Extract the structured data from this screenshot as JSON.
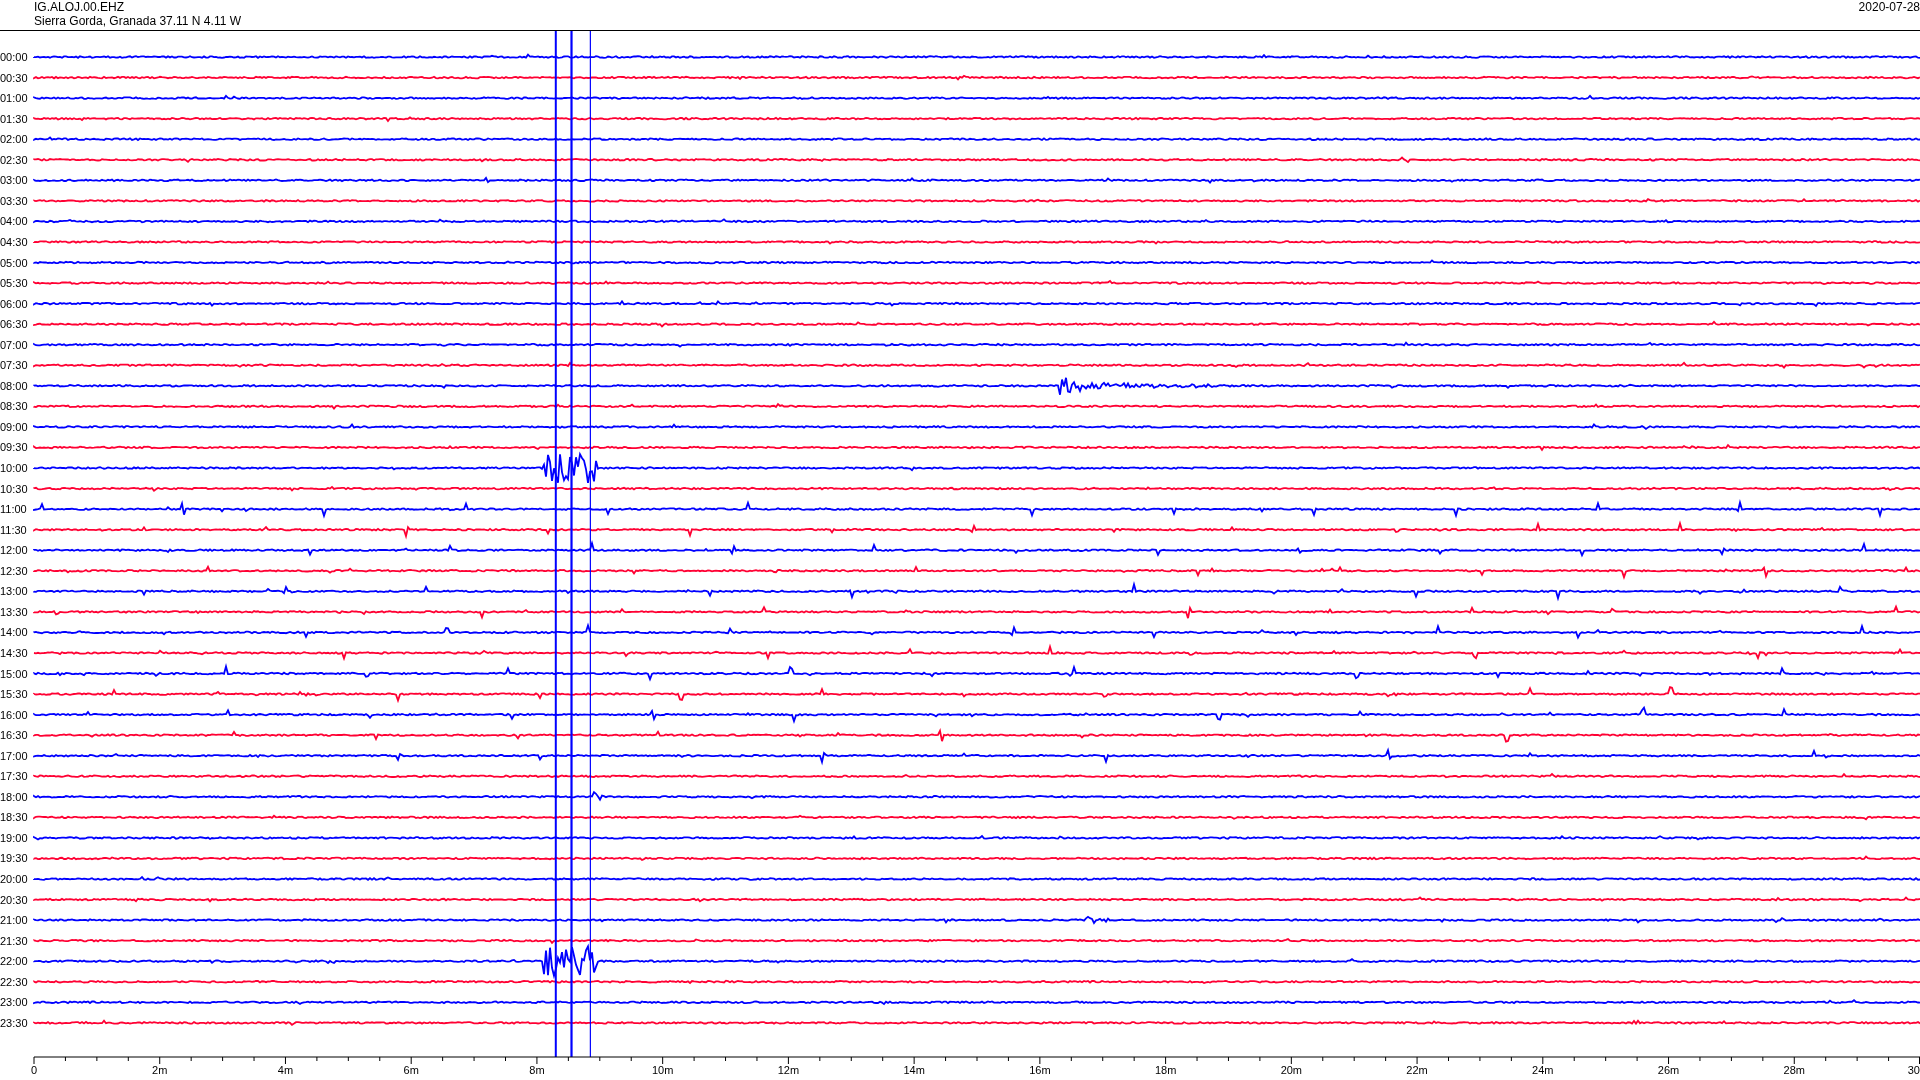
{
  "header": {
    "station": "IG.ALOJ.00.EHZ",
    "location": "Sierra Gorda, Granada  37.11 N 4.11 W",
    "date": "2020-07-28"
  },
  "rows": [
    {
      "label": "00:00",
      "color": "#0000ff"
    },
    {
      "label": "00:30",
      "color": "#ff0033"
    },
    {
      "label": "01:00",
      "color": "#0000ff"
    },
    {
      "label": "01:30",
      "color": "#ff0033"
    },
    {
      "label": "02:00",
      "color": "#0000ff"
    },
    {
      "label": "02:30",
      "color": "#ff0033"
    },
    {
      "label": "03:00",
      "color": "#0000ff"
    },
    {
      "label": "03:30",
      "color": "#ff0033"
    },
    {
      "label": "04:00",
      "color": "#0000ff"
    },
    {
      "label": "04:30",
      "color": "#ff0033"
    },
    {
      "label": "05:00",
      "color": "#0000ff"
    },
    {
      "label": "05:30",
      "color": "#ff0033"
    },
    {
      "label": "06:00",
      "color": "#0000ff"
    },
    {
      "label": "06:30",
      "color": "#ff0033"
    },
    {
      "label": "07:00",
      "color": "#0000ff"
    },
    {
      "label": "07:30",
      "color": "#ff0033"
    },
    {
      "label": "08:00",
      "color": "#0000ff"
    },
    {
      "label": "08:30",
      "color": "#ff0033"
    },
    {
      "label": "09:00",
      "color": "#0000ff"
    },
    {
      "label": "09:30",
      "color": "#ff0033"
    },
    {
      "label": "10:00",
      "color": "#0000ff"
    },
    {
      "label": "10:30",
      "color": "#ff0033"
    },
    {
      "label": "11:00",
      "color": "#0000ff"
    },
    {
      "label": "11:30",
      "color": "#ff0033"
    },
    {
      "label": "12:00",
      "color": "#0000ff"
    },
    {
      "label": "12:30",
      "color": "#ff0033"
    },
    {
      "label": "13:00",
      "color": "#0000ff"
    },
    {
      "label": "13:30",
      "color": "#ff0033"
    },
    {
      "label": "14:00",
      "color": "#0000ff"
    },
    {
      "label": "14:30",
      "color": "#ff0033"
    },
    {
      "label": "15:00",
      "color": "#0000ff"
    },
    {
      "label": "15:30",
      "color": "#ff0033"
    },
    {
      "label": "16:00",
      "color": "#0000ff"
    },
    {
      "label": "16:30",
      "color": "#ff0033"
    },
    {
      "label": "17:00",
      "color": "#0000ff"
    },
    {
      "label": "17:30",
      "color": "#ff0033"
    },
    {
      "label": "18:00",
      "color": "#0000ff"
    },
    {
      "label": "18:30",
      "color": "#ff0033"
    },
    {
      "label": "19:00",
      "color": "#0000ff"
    },
    {
      "label": "19:30",
      "color": "#ff0033"
    },
    {
      "label": "20:00",
      "color": "#0000ff"
    },
    {
      "label": "20:30",
      "color": "#ff0033"
    },
    {
      "label": "21:00",
      "color": "#0000ff"
    },
    {
      "label": "21:30",
      "color": "#ff0033"
    },
    {
      "label": "22:00",
      "color": "#0000ff"
    },
    {
      "label": "22:30",
      "color": "#ff0033"
    },
    {
      "label": "23:00",
      "color": "#0000ff"
    },
    {
      "label": "23:30",
      "color": "#ff0033"
    }
  ],
  "x_axis": {
    "ticks": [
      "0",
      "2m",
      "4m",
      "6m",
      "8m",
      "10m",
      "12m",
      "14m",
      "16m",
      "18m",
      "20m",
      "22m",
      "24m",
      "26m",
      "28m",
      "30"
    ]
  }
}
